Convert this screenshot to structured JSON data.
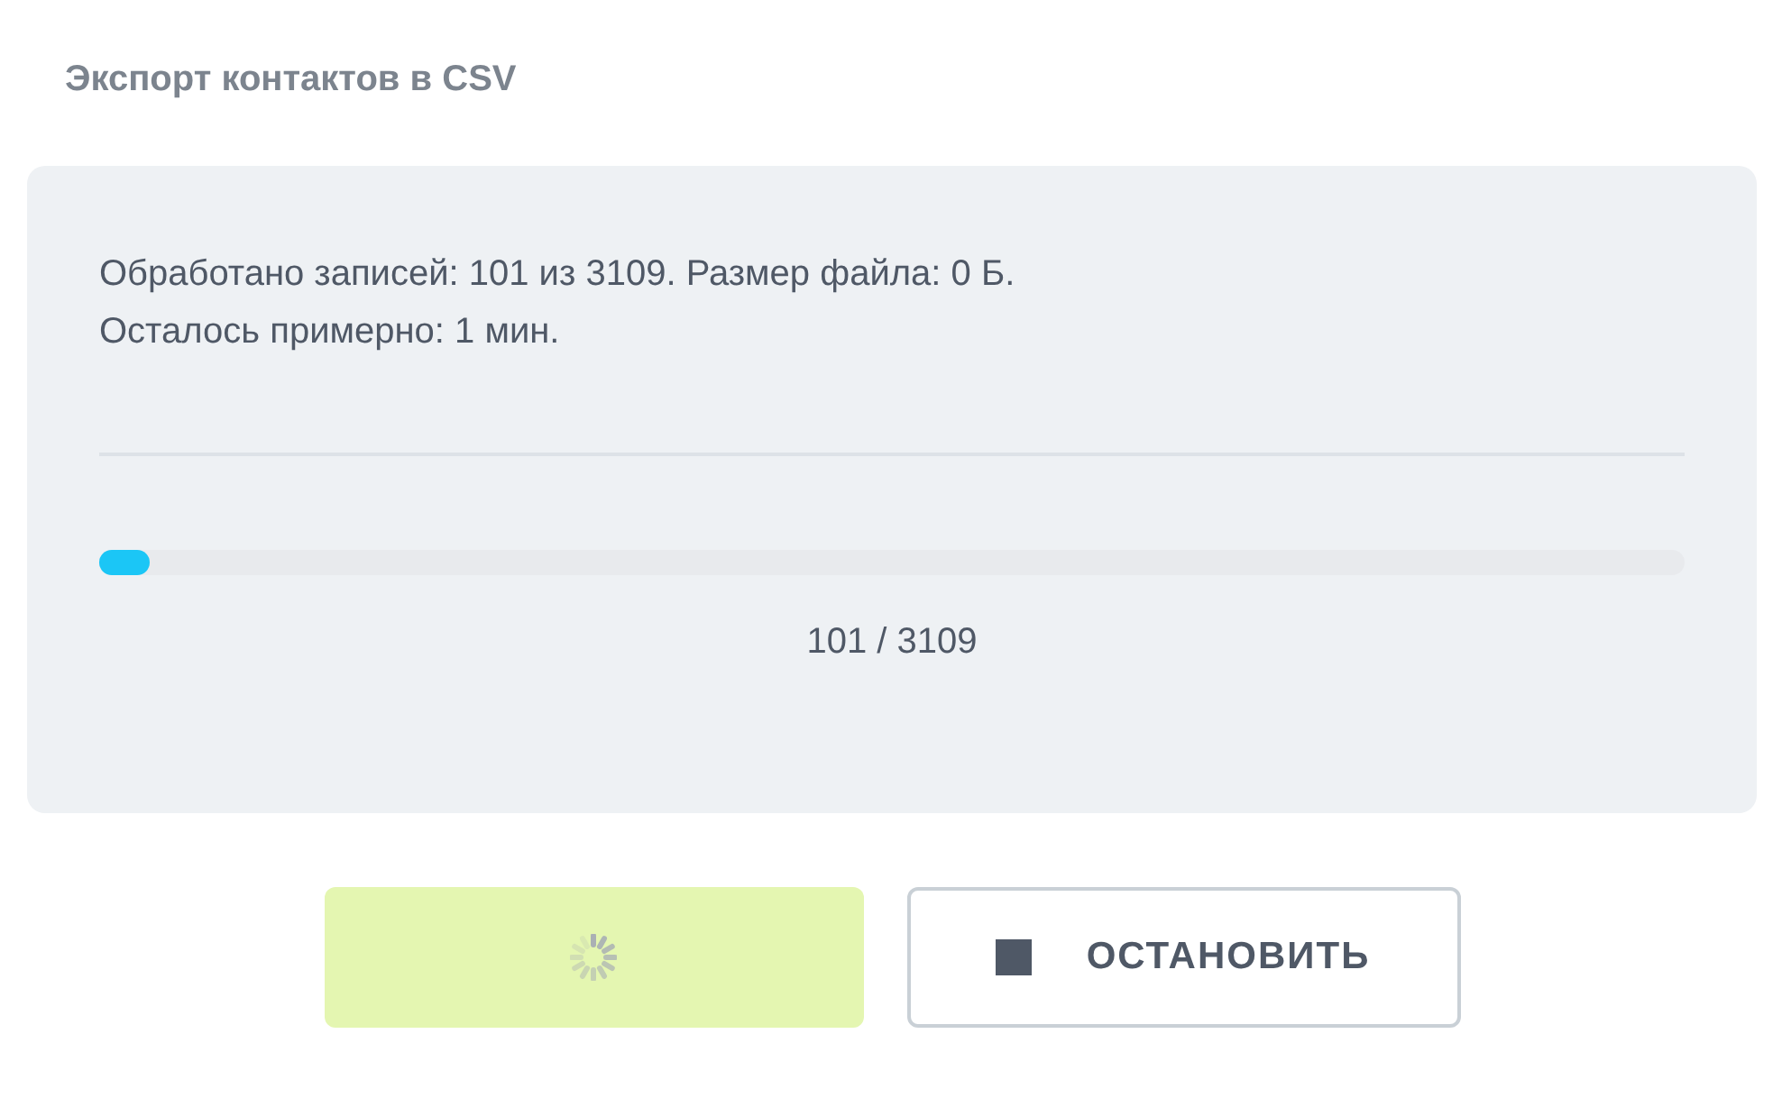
{
  "dialog": {
    "title": "Экспорт контактов в CSV"
  },
  "status": {
    "lines": [
      "Обработано записей: 101 из 3109. Размер файла: 0 Б.",
      "Осталось примерно: 1 мин."
    ]
  },
  "progress": {
    "level": 0.032,
    "label": "101 / 3109"
  },
  "buttons": [
    {
      "kind": "primary",
      "loading": true
    },
    {
      "kind": "stop",
      "label": "ОСТАНОВИТЬ"
    }
  ]
}
